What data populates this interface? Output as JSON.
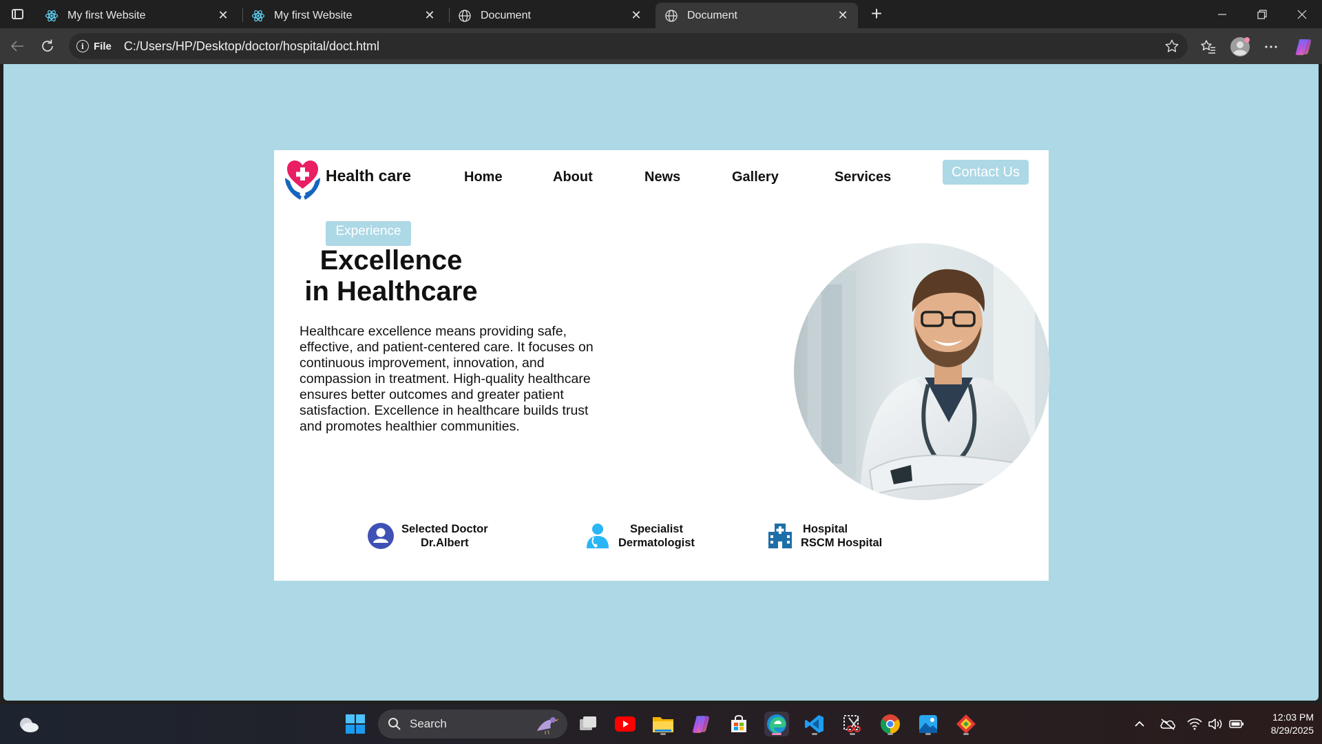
{
  "browser": {
    "tabs": [
      {
        "title": "My first Website",
        "icon": "react-icon",
        "active": false
      },
      {
        "title": "My first Website",
        "icon": "react-icon",
        "active": false
      },
      {
        "title": "Document",
        "icon": "globe-icon",
        "active": false
      },
      {
        "title": "Document",
        "icon": "globe-icon",
        "active": true
      }
    ],
    "address": {
      "scheme_label": "File",
      "url": "C:/Users/HP/Desktop/doctor/hospital/doct.html"
    }
  },
  "site": {
    "brand": "Health care",
    "nav": [
      "Home",
      "About",
      "News",
      "Gallery",
      "Services"
    ],
    "contact_label": "Contact Us",
    "hero": {
      "badge": "Experience",
      "title_line1": "Excellence",
      "title_line2": "in Healthcare",
      "description": "Healthcare excellence means providing safe, effective, and patient-centered care. It focuses on continuous improvement, innovation, and compassion in treatment. High-quality healthcare ensures better outcomes and greater patient satisfaction. Excellence in healthcare builds trust and promotes healthier communities."
    },
    "stats": [
      {
        "label": "Selected Doctor",
        "value": "Dr.Albert",
        "icon": "user-circle-icon"
      },
      {
        "label": "Specialist",
        "value": "Dermatologist",
        "icon": "doctor-icon"
      },
      {
        "label": "Hospital",
        "value": "RSCM Hospital",
        "icon": "hospital-icon"
      }
    ],
    "colors": {
      "background": "#add8e6",
      "accent": "#add8e6",
      "logo_heart": "#e91e63",
      "logo_hands": "#1565c0"
    }
  },
  "taskbar": {
    "search_placeholder": "Search",
    "time": "12:03 PM",
    "date": "8/29/2025"
  }
}
